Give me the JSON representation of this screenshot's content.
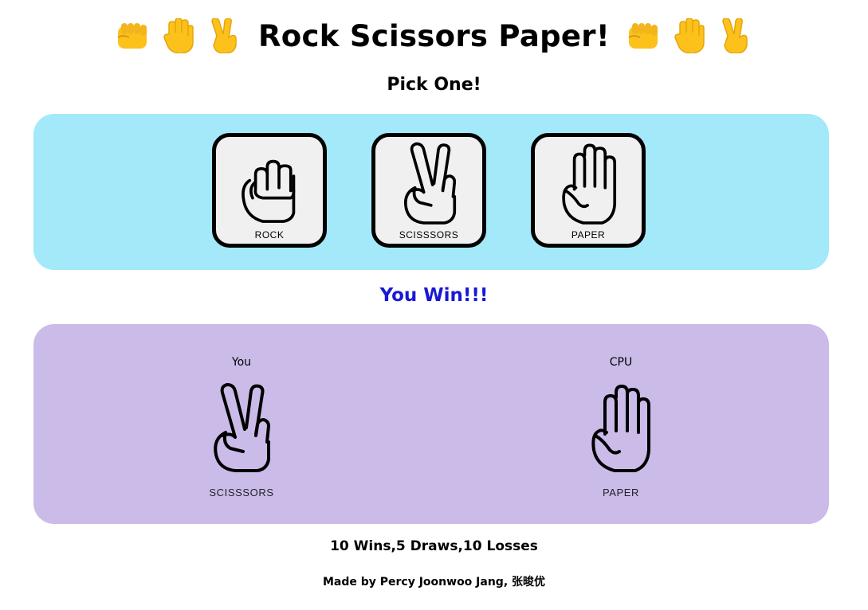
{
  "header": {
    "title": "Rock Scissors Paper!",
    "emoji_left": [
      "fist-emoji",
      "raised-hand-emoji",
      "victory-hand-emoji"
    ],
    "emoji_right": [
      "fist-emoji",
      "raised-hand-emoji",
      "victory-hand-emoji"
    ]
  },
  "pick": {
    "heading": "Pick One!"
  },
  "choices": [
    {
      "label": "ROCK",
      "icon": "rock-hand-icon"
    },
    {
      "label": "SCISSSORS",
      "icon": "scissors-hand-icon"
    },
    {
      "label": "PAPER",
      "icon": "paper-hand-icon"
    }
  ],
  "result": {
    "text": "You Win!!!",
    "color": "#1818d6"
  },
  "match": {
    "player": {
      "label": "You",
      "move": "SCISSSORS"
    },
    "cpu": {
      "label": "CPU",
      "move": "PAPER"
    }
  },
  "score": {
    "text": "10 Wins,5 Draws,10 Losses"
  },
  "footer": {
    "credit": "Made by Percy Joonwoo Jang, 张晙优"
  },
  "colors": {
    "choice_panel": "#a3e9f9",
    "match_panel": "#cbbbe9",
    "button_bg": "#f0f0f0",
    "emoji_yellow": "#fcc21b"
  }
}
